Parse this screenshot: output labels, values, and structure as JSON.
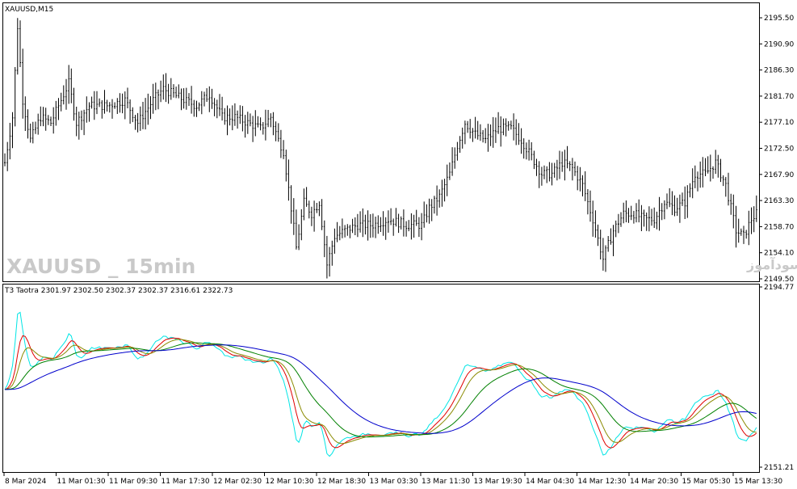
{
  "main_pane": {
    "title": "XAUUSD,M15",
    "watermark_left": "XAUUSD _ 15min",
    "watermark_right": "انتشار در سایت سودآموز"
  },
  "indicator_pane": {
    "title": "T3 Taotra 2301.97 2302.50 2302.37 2302.37 2316.61 2322.73"
  },
  "colors": {
    "background": "#ffffff",
    "grid_frame": "#000000",
    "bars": "#000000",
    "line_cyan": "#00e5e5",
    "line_red": "#e00000",
    "line_olive": "#8a8a00",
    "line_green": "#008000",
    "line_blue": "#0000cc"
  },
  "chart_data": [
    {
      "type": "ohlc",
      "title": "XAUUSD,M15",
      "ylim": [
        2149.5,
        2196.5
      ],
      "y_ticks": [
        "2195.50",
        "2190.90",
        "2186.30",
        "2181.70",
        "2177.10",
        "2172.50",
        "2167.90",
        "2163.30",
        "2158.70",
        "2154.10",
        "2149.50"
      ],
      "x_ticks": [
        "8 Mar 2024",
        "11 Mar 01:30",
        "11 Mar 09:30",
        "11 Mar 17:30",
        "12 Mar 02:30",
        "12 Mar 10:30",
        "12 Mar 18:30",
        "13 Mar 03:30",
        "13 Mar 11:30",
        "13 Mar 19:30",
        "14 Mar 04:30",
        "14 Mar 12:30",
        "14 Mar 20:30",
        "15 Mar 05:30",
        "15 Mar 13:30"
      ],
      "anchors": [
        [
          0,
          2170
        ],
        [
          3,
          2178
        ],
        [
          5,
          2194
        ],
        [
          7,
          2181
        ],
        [
          10,
          2174
        ],
        [
          14,
          2178
        ],
        [
          18,
          2177
        ],
        [
          22,
          2181
        ],
        [
          25,
          2184
        ],
        [
          28,
          2177
        ],
        [
          33,
          2180
        ],
        [
          40,
          2180
        ],
        [
          47,
          2181
        ],
        [
          52,
          2177
        ],
        [
          58,
          2181
        ],
        [
          62,
          2183
        ],
        [
          66,
          2182
        ],
        [
          70,
          2181
        ],
        [
          75,
          2180
        ],
        [
          80,
          2182
        ],
        [
          85,
          2178
        ],
        [
          90,
          2178
        ],
        [
          95,
          2177
        ],
        [
          100,
          2176
        ],
        [
          104,
          2178
        ],
        [
          107,
          2174
        ],
        [
          109,
          2172
        ],
        [
          112,
          2162
        ],
        [
          114,
          2155
        ],
        [
          117,
          2163
        ],
        [
          120,
          2161
        ],
        [
          123,
          2163
        ],
        [
          126,
          2152
        ],
        [
          129,
          2157
        ],
        [
          133,
          2158
        ],
        [
          138,
          2159
        ],
        [
          144,
          2159
        ],
        [
          150,
          2160
        ],
        [
          157,
          2159
        ],
        [
          163,
          2159
        ],
        [
          166,
          2162
        ],
        [
          170,
          2164
        ],
        [
          174,
          2168
        ],
        [
          177,
          2173
        ],
        [
          180,
          2177
        ],
        [
          184,
          2175
        ],
        [
          188,
          2174
        ],
        [
          193,
          2176
        ],
        [
          198,
          2176
        ],
        [
          202,
          2174
        ],
        [
          206,
          2171
        ],
        [
          210,
          2168
        ],
        [
          214,
          2168
        ],
        [
          218,
          2170
        ],
        [
          222,
          2169
        ],
        [
          226,
          2166
        ],
        [
          230,
          2160
        ],
        [
          234,
          2153
        ],
        [
          238,
          2158
        ],
        [
          242,
          2161
        ],
        [
          246,
          2161
        ],
        [
          250,
          2160
        ],
        [
          254,
          2160
        ],
        [
          258,
          2163
        ],
        [
          262,
          2162
        ],
        [
          266,
          2163
        ],
        [
          270,
          2168
        ],
        [
          274,
          2168
        ],
        [
          278,
          2170
        ],
        [
          282,
          2166
        ],
        [
          286,
          2158
        ],
        [
          289,
          2157
        ],
        [
          292,
          2160
        ],
        [
          294,
          2161
        ]
      ]
    },
    {
      "type": "line",
      "title": "T3 Taotra",
      "values_label": [
        "2301.97",
        "2302.50",
        "2302.37",
        "2302.37",
        "2316.61",
        "2322.73"
      ],
      "ylim": [
        2151.21,
        2194.77
      ],
      "y_ticks": [
        "2194.77",
        "2151.21"
      ],
      "series": [
        {
          "color": "#00e5e5",
          "smoothing": 1.5
        },
        {
          "color": "#e00000",
          "smoothing": 3
        },
        {
          "color": "#8a8a00",
          "smoothing": 4.5
        },
        {
          "color": "#008000",
          "smoothing": 9
        },
        {
          "color": "#0000cc",
          "smoothing": 16
        }
      ]
    }
  ]
}
